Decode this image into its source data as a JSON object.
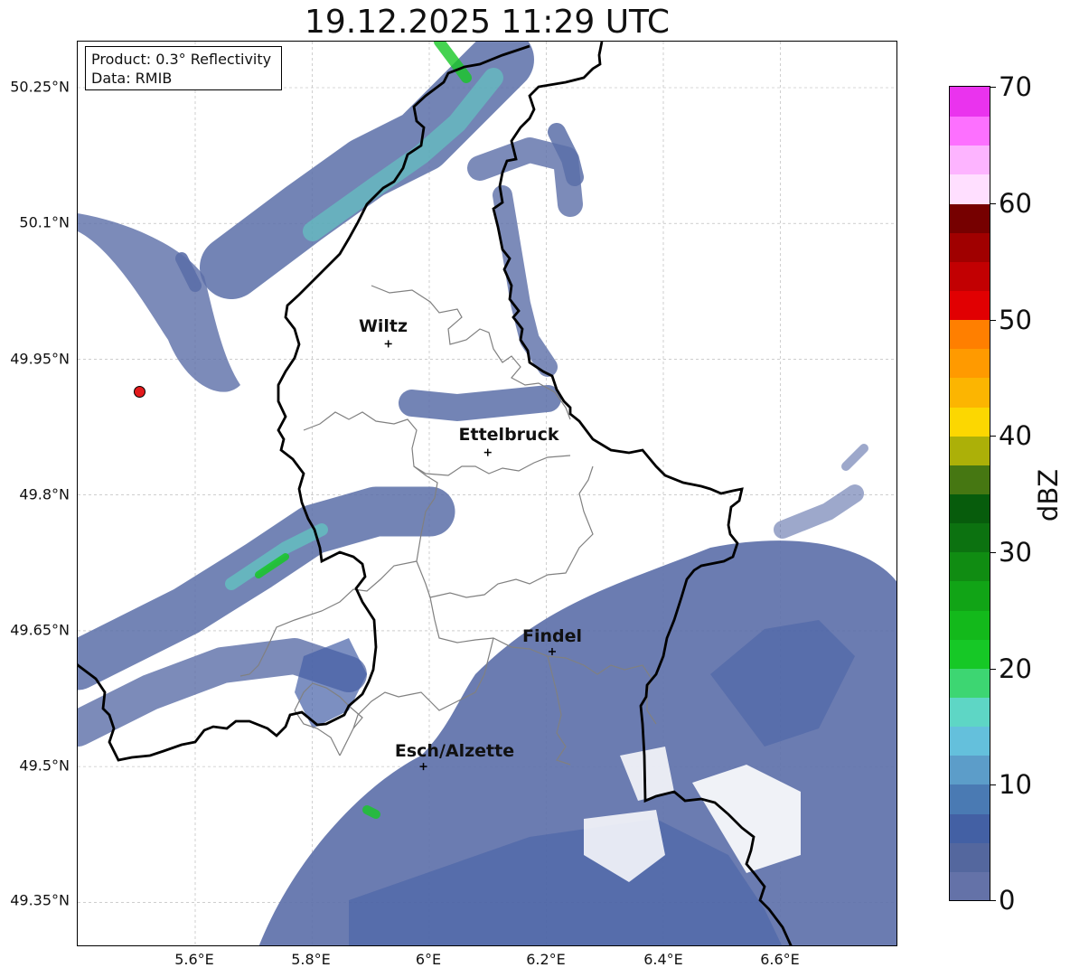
{
  "title": "19.12.2025 11:29 UTC",
  "info_box": {
    "product": "Product: 0.3° Reflectivity",
    "data_source": "Data: RMIB"
  },
  "y_ticks": [
    "50.25°N",
    "50.1°N",
    "49.95°N",
    "49.8°N",
    "49.65°N",
    "49.5°N",
    "49.35°N"
  ],
  "x_ticks": [
    "5.6°E",
    "5.8°E",
    "6°E",
    "6.2°E",
    "6.4°E",
    "6.6°E"
  ],
  "cities": [
    {
      "name": "Wiltz",
      "lon": 5.93,
      "lat": 49.967
    },
    {
      "name": "Ettelbruck",
      "lon": 6.1,
      "lat": 49.847
    },
    {
      "name": "Findel",
      "lon": 6.21,
      "lat": 49.627
    },
    {
      "name": "Esch/Alzette",
      "lon": 5.99,
      "lat": 49.5
    }
  ],
  "radar_site": {
    "lon": 5.505,
    "lat": 49.914,
    "color": "#e31a1c"
  },
  "colorbar": {
    "unit": "dBZ",
    "min": 0,
    "max": 70,
    "tick_labels": [
      "70",
      "60",
      "50",
      "40",
      "30",
      "20",
      "10",
      "0"
    ],
    "colors": [
      "#6472a8",
      "#54679e",
      "#4360a4",
      "#4a7ab3",
      "#5c9dc9",
      "#64c0dc",
      "#5ed6c5",
      "#3dd672",
      "#16c826",
      "#13b91b",
      "#11a416",
      "#108c12",
      "#0c7210",
      "#075c0c",
      "#467712",
      "#acb008",
      "#fcd701",
      "#fcb501",
      "#ff9a00",
      "#ff7f00",
      "#e10002",
      "#c20002",
      "#a00000",
      "#760000",
      "#ffdfff",
      "#fdb4ff",
      "#fd70ff",
      "#ea33ee"
    ]
  },
  "colors": {
    "rain_light": "#5b6ea8",
    "rain_mid": "#4560a6",
    "rain_cyan": "#5ed6c5",
    "rain_green": "#16c826",
    "border_national": "#000000",
    "border_cantonal": "#808080",
    "grid": "#b0b0b0"
  }
}
